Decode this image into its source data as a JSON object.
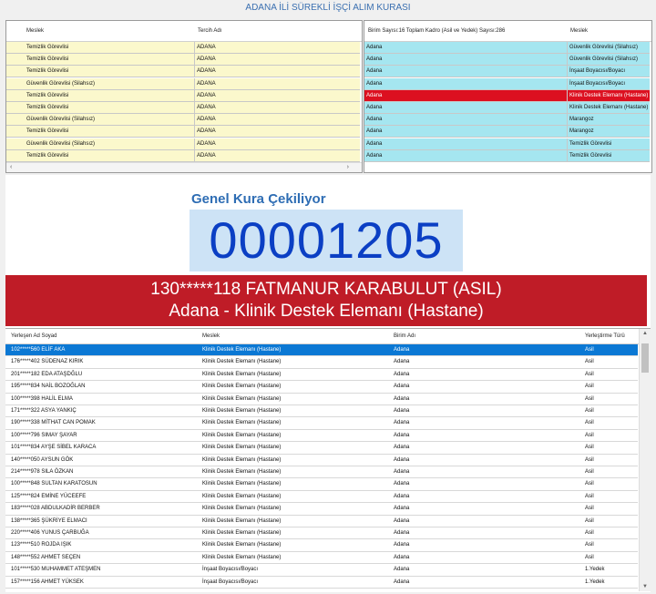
{
  "title": "ADANA İLİ SÜREKLİ İŞÇİ ALIM KURASI",
  "left_table": {
    "headers": [
      "Meslek",
      "Tercih Adı"
    ],
    "rows": [
      [
        "Temizlik Görevlisi",
        "ADANA"
      ],
      [
        "Temizlik Görevlisi",
        "ADANA"
      ],
      [
        "Temizlik Görevlisi",
        "ADANA"
      ],
      [
        "Güvenlik Görevlisi (Silahsız)",
        "ADANA"
      ],
      [
        "Temizlik Görevlisi",
        "ADANA"
      ],
      [
        "Temizlik Görevlisi",
        "ADANA"
      ],
      [
        "Güvenlik Görevlisi (Silahsız)",
        "ADANA"
      ],
      [
        "Temizlik Görevlisi",
        "ADANA"
      ],
      [
        "Güvenlik Görevlisi (Silahsız)",
        "ADANA"
      ],
      [
        "Temizlik Görevlisi",
        "ADANA"
      ]
    ]
  },
  "right_table": {
    "headers": [
      "Birim Sayısı:16 Toplam Kadro (Asil ve Yedek) Sayısı:286",
      "Meslek"
    ],
    "selected_index": 4,
    "rows": [
      [
        "Adana",
        "Güvenlik Görevlisi (Silahsız)"
      ],
      [
        "Adana",
        "Güvenlik Görevlisi (Silahsız)"
      ],
      [
        "Adana",
        "İnşaat Boyacısı/Boyacı"
      ],
      [
        "Adana",
        "İnşaat Boyacısı/Boyacı"
      ],
      [
        "Adana",
        "Klinik Destek Elemanı (Hastane)"
      ],
      [
        "Adana",
        "Klinik Destek Elemanı (Hastane)"
      ],
      [
        "Adana",
        "Marangoz"
      ],
      [
        "Adana",
        "Marangoz"
      ],
      [
        "Adana",
        "Temizlik Görevlisi"
      ],
      [
        "Adana",
        "Temizlik Görevlisi"
      ]
    ]
  },
  "draw": {
    "label": "Genel Kura Çekiliyor",
    "number": "00001205",
    "winner_line1": "130*****118 FATMANUR KARABULUT (ASIL)",
    "winner_line2": "Adana - Klinik Destek Elemanı (Hastane)"
  },
  "results": {
    "headers": [
      "Yerleşen Ad Soyad",
      "Meslek",
      "Birim Adı",
      "Yerleştirme Türü"
    ],
    "selected_index": 0,
    "rows": [
      [
        "102*****560 ELİF AKA",
        "Klinik Destek Elemanı (Hastane)",
        "Adana",
        "Asil"
      ],
      [
        "176*****402 SÜDENAZ KIRIK",
        "Klinik Destek Elemanı (Hastane)",
        "Adana",
        "Asil"
      ],
      [
        "201*****182 EDA ATAŞDĞLU",
        "Klinik Destek Elemanı (Hastane)",
        "Adana",
        "Asil"
      ],
      [
        "195*****834 NAİL BOZOĞLAN",
        "Klinik Destek Elemanı (Hastane)",
        "Adana",
        "Asil"
      ],
      [
        "100*****398 HALİL ELMA",
        "Klinik Destek Elemanı (Hastane)",
        "Adana",
        "Asil"
      ],
      [
        "171*****322 ASYA YANKIÇ",
        "Klinik Destek Elemanı (Hastane)",
        "Adana",
        "Asil"
      ],
      [
        "190*****338 MİTHAT CAN POMAK",
        "Klinik Destek Elemanı (Hastane)",
        "Adana",
        "Asil"
      ],
      [
        "100*****796 SIMAY ŞAYAR",
        "Klinik Destek Elemanı (Hastane)",
        "Adana",
        "Asil"
      ],
      [
        "101*****834 AYŞE SİBEL KARACA",
        "Klinik Destek Elemanı (Hastane)",
        "Adana",
        "Asil"
      ],
      [
        "140*****050 AYSUN GÖK",
        "Klinik Destek Elemanı (Hastane)",
        "Adana",
        "Asil"
      ],
      [
        "214*****978 SILA ÖZKAN",
        "Klinik Destek Elemanı (Hastane)",
        "Adana",
        "Asil"
      ],
      [
        "100*****848 SULTAN KARATOSUN",
        "Klinik Destek Elemanı (Hastane)",
        "Adana",
        "Asil"
      ],
      [
        "125*****824 EMİNE YÜCEEFE",
        "Klinik Destek Elemanı (Hastane)",
        "Adana",
        "Asil"
      ],
      [
        "183*****028 ABDULKADİR BERBER",
        "Klinik Destek Elemanı (Hastane)",
        "Adana",
        "Asil"
      ],
      [
        "138*****365 ŞÜKRİYE ELMACI",
        "Klinik Destek Elemanı (Hastane)",
        "Adana",
        "Asil"
      ],
      [
        "220*****406 YUNUS ÇARBUĞA",
        "Klinik Destek Elemanı (Hastane)",
        "Adana",
        "Asil"
      ],
      [
        "123*****510 ROJDA IŞIK",
        "Klinik Destek Elemanı (Hastane)",
        "Adana",
        "Asil"
      ],
      [
        "148*****552 AHMET SEÇEN",
        "Klinik Destek Elemanı (Hastane)",
        "Adana",
        "Asil"
      ],
      [
        "101*****530 MUHAMMET ATEŞMEN",
        "İnşaat Boyacısı/Boyacı",
        "Adana",
        "1.Yedek"
      ],
      [
        "157*****156 AHMET YÜKSEK",
        "İnşaat Boyacısı/Boyacı",
        "Adana",
        "1.Yedek"
      ]
    ]
  },
  "colors": {
    "left_row_bg": "#fbf8cc",
    "right_row_bg": "#a5e6f0",
    "right_selected_bg": "#dc1020",
    "results_selected_bg": "#0b78d4"
  }
}
